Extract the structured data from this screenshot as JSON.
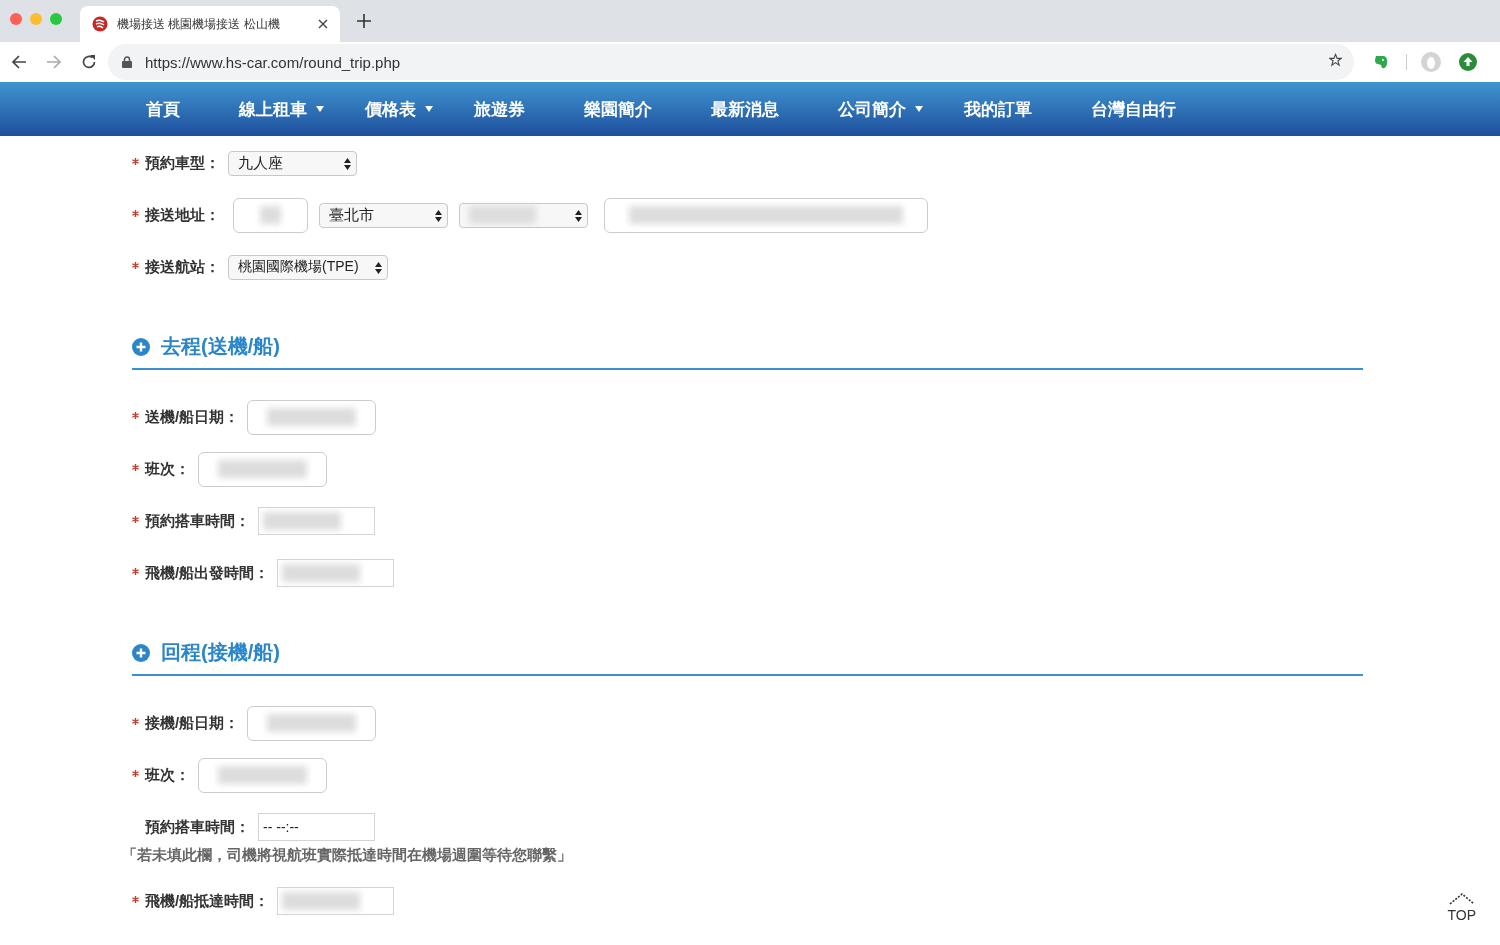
{
  "browser": {
    "tab_title": "機場接送 桃園機場接送 松山機",
    "url": "https://www.hs-car.com/round_trip.php"
  },
  "nav": [
    {
      "label": "首頁",
      "dropdown": false
    },
    {
      "label": "線上租車",
      "dropdown": true
    },
    {
      "label": "價格表",
      "dropdown": true
    },
    {
      "label": "旅遊券",
      "dropdown": false
    },
    {
      "label": "樂園簡介",
      "dropdown": false
    },
    {
      "label": "最新消息",
      "dropdown": false
    },
    {
      "label": "公司簡介",
      "dropdown": true
    },
    {
      "label": "我的訂單",
      "dropdown": false
    },
    {
      "label": "台灣自由行",
      "dropdown": false
    }
  ],
  "sections": [
    {
      "fields": [
        {
          "label": "預約車型：",
          "required": true,
          "controls": [
            {
              "kind": "select",
              "value": "九人座"
            }
          ]
        },
        {
          "label": "接送地址：",
          "required": true,
          "controls": [
            {
              "kind": "zip",
              "redacted": true
            },
            {
              "kind": "select",
              "value": "臺北市"
            },
            {
              "kind": "select",
              "redacted": true
            },
            {
              "kind": "address",
              "redacted": true
            }
          ]
        },
        {
          "label": "接送航站：",
          "required": true,
          "controls": [
            {
              "kind": "select-wide",
              "value": "桃園國際機場(TPE)"
            }
          ]
        }
      ]
    },
    {
      "title": "去程(送機/船)",
      "fields": [
        {
          "label": "送機/船日期：",
          "required": true,
          "controls": [
            {
              "kind": "text",
              "redacted": true
            }
          ]
        },
        {
          "label": "班次：",
          "required": true,
          "controls": [
            {
              "kind": "text",
              "redacted": true
            }
          ]
        },
        {
          "label": "預約搭車時間：",
          "required": true,
          "controls": [
            {
              "kind": "time",
              "redacted": true
            }
          ]
        },
        {
          "label": "飛機/船出發時間：",
          "required": true,
          "controls": [
            {
              "kind": "time",
              "redacted": true
            }
          ]
        }
      ]
    },
    {
      "title": "回程(接機/船)",
      "fields": [
        {
          "label": "接機/船日期：",
          "required": true,
          "controls": [
            {
              "kind": "text",
              "redacted": true
            }
          ]
        },
        {
          "label": "班次：",
          "required": true,
          "controls": [
            {
              "kind": "text",
              "redacted": true
            }
          ]
        },
        {
          "label": "預約搭車時間：",
          "required": false,
          "controls": [
            {
              "kind": "time",
              "placeholder": "-- --:--"
            }
          ],
          "note": "「若未填此欄，司機將視航班實際抵達時間在機場週圍等待您聯繫」"
        },
        {
          "label": "飛機/船抵達時間：",
          "required": true,
          "controls": [
            {
              "kind": "time",
              "redacted": true
            }
          ]
        }
      ]
    }
  ],
  "back_to_top": "TOP"
}
